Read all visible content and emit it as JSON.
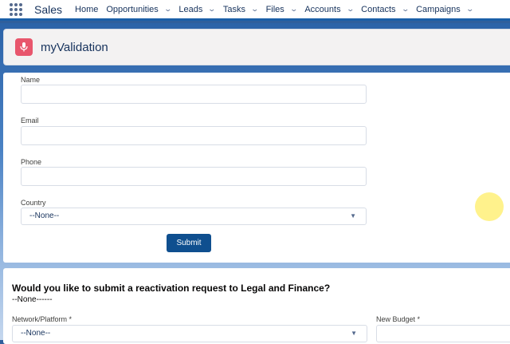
{
  "nav": {
    "app_name": "Sales",
    "items": [
      {
        "label": "Home",
        "has_menu": false
      },
      {
        "label": "Opportunities",
        "has_menu": true
      },
      {
        "label": "Leads",
        "has_menu": true
      },
      {
        "label": "Tasks",
        "has_menu": true
      },
      {
        "label": "Files",
        "has_menu": true
      },
      {
        "label": "Accounts",
        "has_menu": true
      },
      {
        "label": "Contacts",
        "has_menu": true
      },
      {
        "label": "Campaigns",
        "has_menu": true
      }
    ]
  },
  "header": {
    "title": "myValidation",
    "icon": "microphone-icon",
    "icon_color": "#e8566c"
  },
  "form": {
    "name_label": "Name",
    "name_value": "",
    "email_label": "Email",
    "email_value": "",
    "phone_label": "Phone",
    "phone_value": "",
    "country_label": "Country",
    "country_selected": "--None--",
    "submit_label": "Submit",
    "submit_color": "#0f4f8f"
  },
  "reactivation": {
    "question": "Would you like to submit a reactivation request to Legal and Finance?",
    "answer": "--None------",
    "network_label": "Network/Platform *",
    "network_selected": "--None--",
    "budget_label": "New Budget *",
    "budget_value": ""
  },
  "colors": {
    "nav_accent": "#1b5fa8",
    "cursor_highlight": "#fff078"
  }
}
